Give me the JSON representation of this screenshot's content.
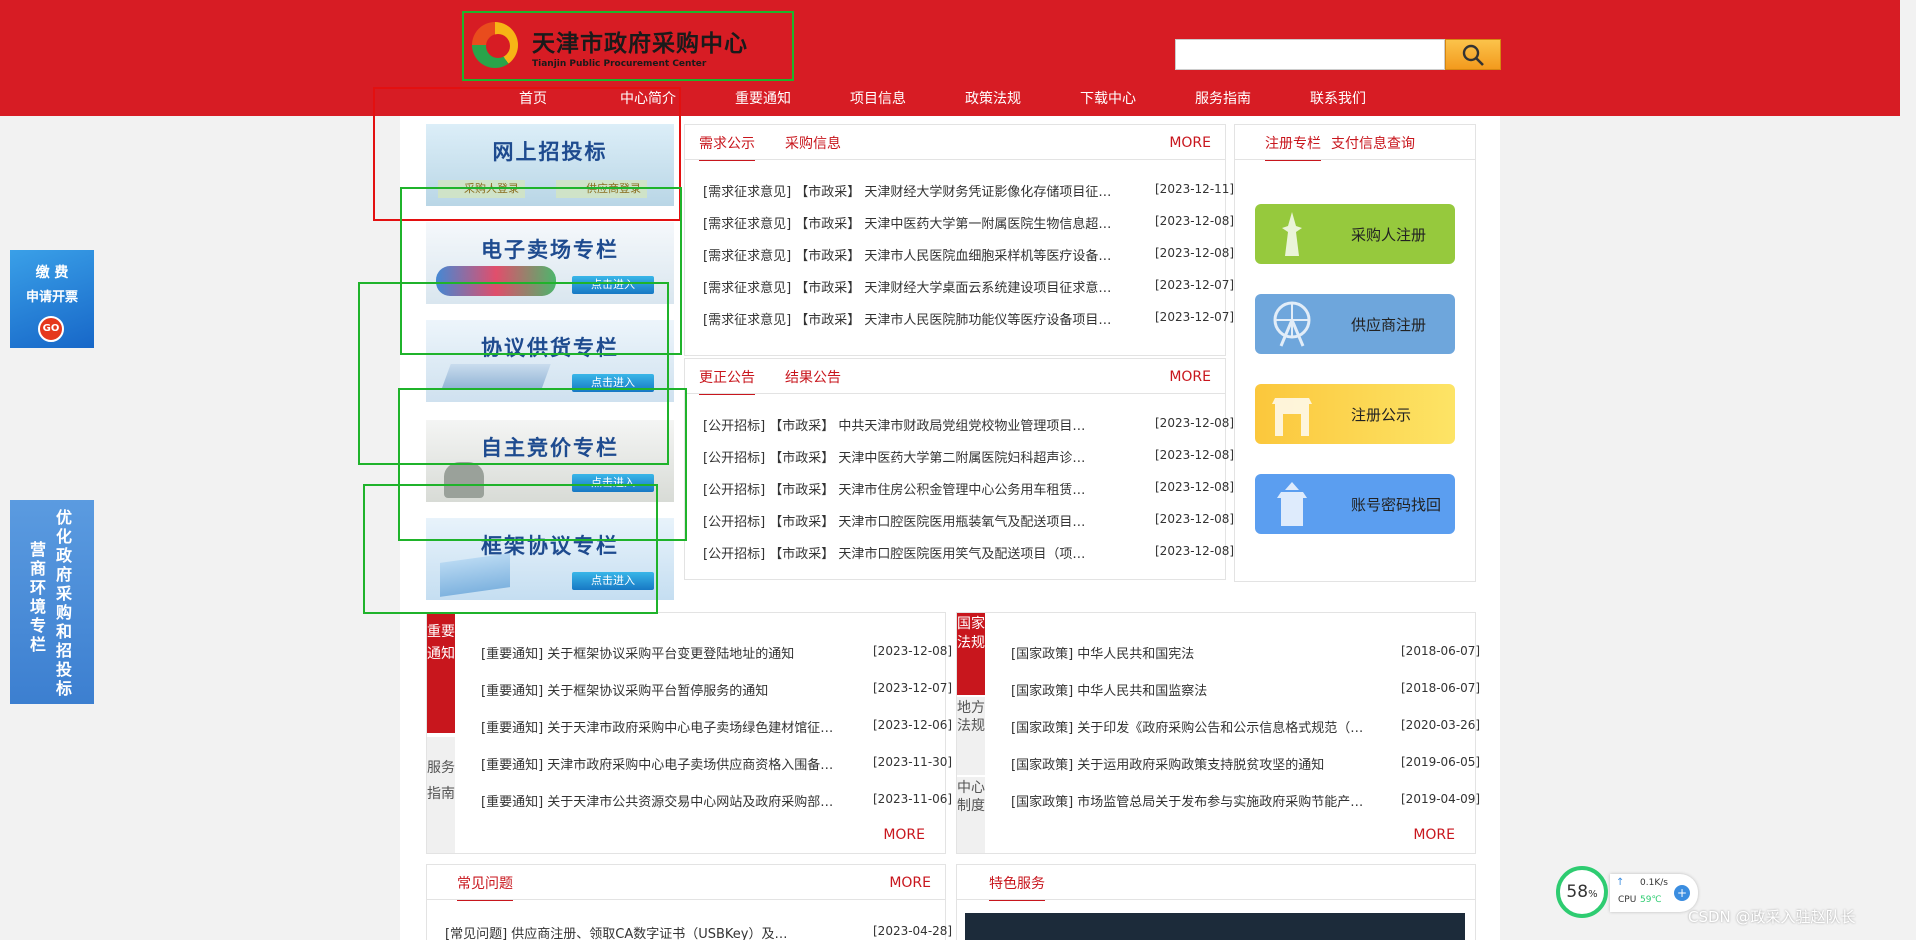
{
  "header": {
    "logo_cn": "天津市政府采购中心",
    "logo_en": "Tianjin Public Procurement Center",
    "search_placeholder": "",
    "search_button": "search-icon"
  },
  "nav": [
    "首页",
    "中心简介",
    "重要通知",
    "项目信息",
    "政策法规",
    "下载中心",
    "服务指南",
    "联系我们"
  ],
  "side_banners": {
    "fee": {
      "line1": "缴 费",
      "line2": "申请开票",
      "go": "GO"
    },
    "env": {
      "col_right": "优化政府采购和招投标",
      "col_left": "营商环境专栏"
    }
  },
  "promos": {
    "online": {
      "title": "网上招投标",
      "buyer_login": "采购人登录",
      "supplier_login": "供应商登录"
    },
    "emall": {
      "title": "电子卖场专栏",
      "enter": "点击进入"
    },
    "agreement": {
      "title": "协议供货专栏",
      "enter": "点击进入"
    },
    "bidding": {
      "title": "自主竞价专栏",
      "enter": "点击进入"
    },
    "framework": {
      "title": "框架协议专栏",
      "enter": "点击进入"
    }
  },
  "demand": {
    "tabs": [
      "需求公示",
      "采购信息"
    ],
    "more": "MORE",
    "rows": [
      {
        "text": "[需求征求意见] 【市政采】 天津财经大学财务凭证影像化存储项目征…",
        "date": "[2023-12-11]"
      },
      {
        "text": "[需求征求意见] 【市政采】 天津中医药大学第一附属医院生物信息超…",
        "date": "[2023-12-08]"
      },
      {
        "text": "[需求征求意见] 【市政采】 天津市人民医院血细胞采样机等医疗设备…",
        "date": "[2023-12-08]"
      },
      {
        "text": "[需求征求意见] 【市政采】 天津财经大学桌面云系统建设项目征求意…",
        "date": "[2023-12-07]"
      },
      {
        "text": "[需求征求意见] 【市政采】 天津市人民医院肺功能仪等医疗设备项目…",
        "date": "[2023-12-07]"
      }
    ]
  },
  "correction": {
    "tabs": [
      "更正公告",
      "结果公告"
    ],
    "more": "MORE",
    "rows": [
      {
        "text": "[公开招标] 【市政采】 中共天津市财政局党组党校物业管理项目…",
        "date": "[2023-12-08]"
      },
      {
        "text": "[公开招标] 【市政采】 天津中医药大学第二附属医院妇科超声诊…",
        "date": "[2023-12-08]"
      },
      {
        "text": "[公开招标] 【市政采】 天津市住房公积金管理中心公务用车租赁…",
        "date": "[2023-12-08]"
      },
      {
        "text": "[公开招标] 【市政采】 天津市口腔医院医用瓶装氧气及配送项目…",
        "date": "[2023-12-08]"
      },
      {
        "text": "[公开招标] 【市政采】 天津市口腔医院医用笑气及配送项目（项…",
        "date": "[2023-12-08]"
      }
    ]
  },
  "register": {
    "tabs": [
      "注册专栏",
      "支付信息查询"
    ],
    "buttons": [
      "采购人注册",
      "供应商注册",
      "注册公示",
      "账号密码找回"
    ],
    "colors": [
      "#96c93d",
      "#6ea6dc",
      "#fbd24e",
      "#5b9ef0"
    ]
  },
  "notices": {
    "vtab_active": "重要通知",
    "vtab_other": "服务指南",
    "more": "MORE",
    "rows": [
      {
        "text": "[重要通知] 关于框架协议采购平台变更登陆地址的通知",
        "date": "[2023-12-08]"
      },
      {
        "text": "[重要通知] 关于框架协议采购平台暂停服务的通知",
        "date": "[2023-12-07]"
      },
      {
        "text": "[重要通知] 关于天津市政府采购中心电子卖场绿色建材馆征…",
        "date": "[2023-12-06]"
      },
      {
        "text": "[重要通知] 天津市政府采购中心电子卖场供应商资格入围备…",
        "date": "[2023-11-30]"
      },
      {
        "text": "[重要通知] 关于天津市公共资源交易中心网站及政府采购部…",
        "date": "[2023-11-06]"
      }
    ]
  },
  "policy": {
    "vtab_active": "国家法规",
    "vtab_local": "地方法规",
    "vtab_center": "中心制度",
    "more": "MORE",
    "rows": [
      {
        "text": "[国家政策] 中华人民共和国宪法",
        "date": "[2018-06-07]"
      },
      {
        "text": "[国家政策] 中华人民共和国监察法",
        "date": "[2018-06-07]"
      },
      {
        "text": "[国家政策] 关于印发《政府采购公告和公示信息格式规范（…",
        "date": "[2020-03-26]"
      },
      {
        "text": "[国家政策] 关于运用政府采购政策支持脱贫攻坚的通知",
        "date": "[2019-06-05]"
      },
      {
        "text": "[国家政策] 市场监管总局关于发布参与实施政府采购节能产…",
        "date": "[2019-04-09]"
      }
    ]
  },
  "faq": {
    "tab": "常见问题",
    "more": "MORE",
    "row": {
      "text": "[常见问题] 供应商注册、领取CA数字证书（USBKey）及…",
      "date": "[2023-04-28]"
    }
  },
  "special": {
    "tab": "特色服务"
  },
  "overlay": {
    "cpu_percent": "58",
    "percent_sign": "%",
    "net_speed": "0.1K/s",
    "cpu_label": "CPU",
    "cpu_temp": "59℃",
    "watermark": "CSDN @政采入驻赵队长"
  }
}
